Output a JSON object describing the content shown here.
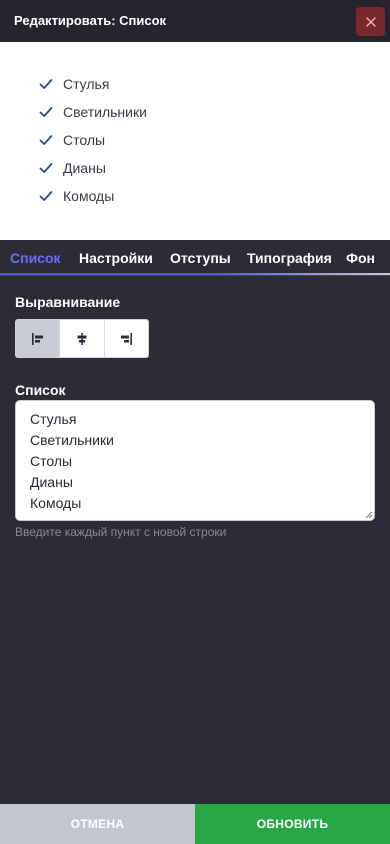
{
  "header": {
    "title": "Редактировать: Список",
    "close_icon": "close-icon"
  },
  "preview": {
    "items": [
      "Стулья",
      "Светильники",
      "Столы",
      "Дианы",
      "Комоды"
    ],
    "check_color": "#1e4f8a"
  },
  "tabs": [
    {
      "label": "Список",
      "active": true
    },
    {
      "label": "Настройки",
      "active": false
    },
    {
      "label": "Отступы",
      "active": false
    },
    {
      "label": "Типография",
      "active": false
    },
    {
      "label": "Фон",
      "active": false
    }
  ],
  "alignment": {
    "label": "Выравнивание",
    "options": [
      "align-left-icon",
      "align-center-icon",
      "align-right-icon"
    ],
    "selected": "align-left-icon"
  },
  "list_field": {
    "label": "Список",
    "value": "Стулья\nСветильники\nСтолы\nДианы\nКомоды",
    "hint": "Введите каждый пункт с новой строки"
  },
  "footer": {
    "cancel_label": "ОТМЕНА",
    "update_label": "ОБНОВИТЬ"
  },
  "colors": {
    "accent": "#5555e0",
    "update": "#27a844",
    "cancel": "#c3c5d0",
    "close_bg": "#7a2730"
  }
}
